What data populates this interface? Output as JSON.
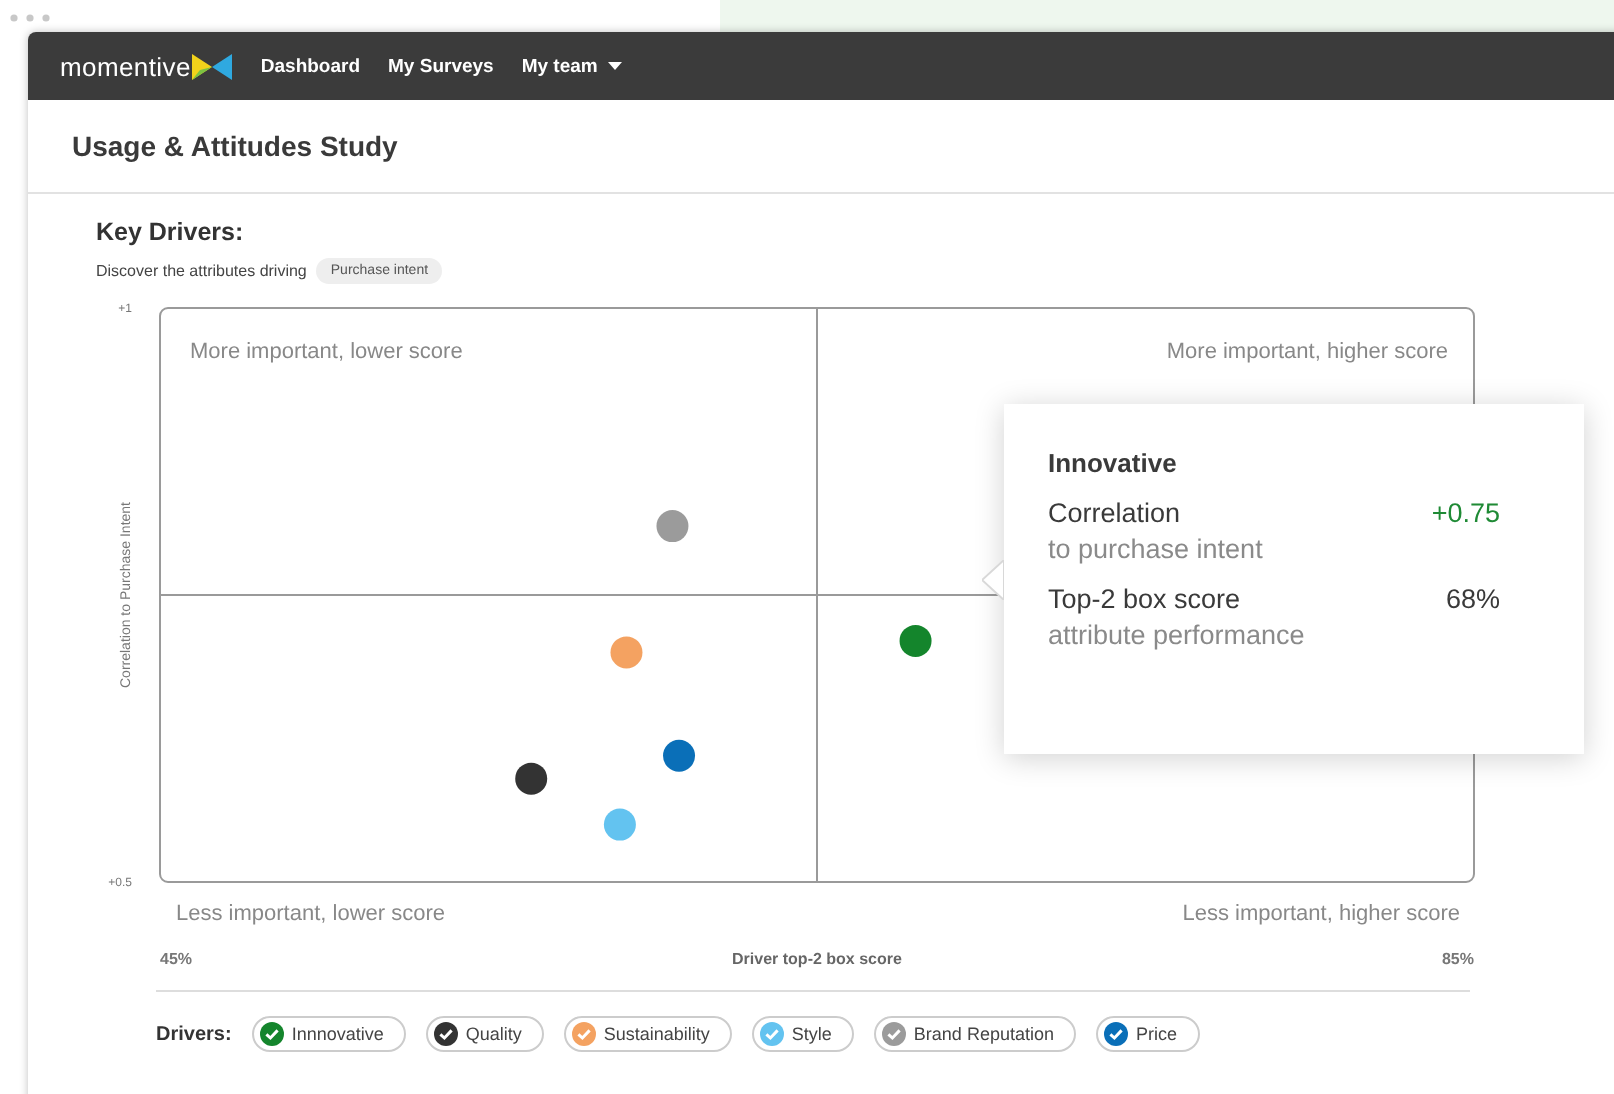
{
  "nav": {
    "brand": "momentive",
    "items": [
      {
        "label": "Dashboard",
        "dropdown": false
      },
      {
        "label": "My Surveys",
        "dropdown": false
      },
      {
        "label": "My team",
        "dropdown": true
      }
    ]
  },
  "page_title": "Usage & Attitudes Study",
  "section": {
    "title": "Key Drivers:",
    "subtitle": "Discover the attributes driving",
    "pill": "Purchase intent"
  },
  "chart": {
    "quadrants": [
      "More important, lower score",
      "More important, higher score",
      "Less important, lower score",
      "Less important, higher score"
    ],
    "chart_data": {
      "type": "scatter",
      "xlabel": "Driver top-2 box score",
      "ylabel": "Correlation to Purchase Intent",
      "xlim": [
        45,
        85
      ],
      "ylim": [
        0.5,
        1
      ],
      "xticks": [
        {
          "value": 45,
          "label": "45%"
        },
        {
          "value": 85,
          "label": "85%"
        }
      ],
      "yticks": [
        {
          "value": 0.5,
          "label": "+0.5"
        },
        {
          "value": 1,
          "label": "+1"
        }
      ],
      "ref_lines": [
        {
          "axis": "x",
          "value": 65
        },
        {
          "axis": "y",
          "value": 0.75
        }
      ],
      "series": [
        {
          "name": "Innnovative",
          "color": "#14852c",
          "x": [
            68
          ],
          "values": [
            0.71
          ]
        },
        {
          "name": "Quality",
          "color": "#333333",
          "x": [
            56.3
          ],
          "values": [
            0.59
          ]
        },
        {
          "name": "Sustainability",
          "color": "#f4a261",
          "x": [
            59.2
          ],
          "values": [
            0.7
          ]
        },
        {
          "name": "Style",
          "color": "#63c3f0",
          "x": [
            59
          ],
          "values": [
            0.55
          ]
        },
        {
          "name": "Brand Reputation",
          "color": "#9b9b9b",
          "x": [
            60.6
          ],
          "values": [
            0.81
          ]
        },
        {
          "name": "Price",
          "color": "#0a6fb8",
          "x": [
            60.8
          ],
          "values": [
            0.61
          ]
        }
      ]
    }
  },
  "tooltip": {
    "title": "Innovative",
    "rows": [
      {
        "label": "Correlation",
        "sub": "to purchase intent",
        "value": "+0.75",
        "positive": true
      },
      {
        "label": "Top-2 box score",
        "sub": "attribute performance",
        "value": "68%",
        "positive": false
      }
    ]
  },
  "drivers": {
    "label": "Drivers:",
    "items": [
      {
        "checked": true
      },
      {
        "checked": true
      },
      {
        "checked": true
      },
      {
        "checked": true
      },
      {
        "checked": true
      },
      {
        "checked": true
      }
    ]
  }
}
